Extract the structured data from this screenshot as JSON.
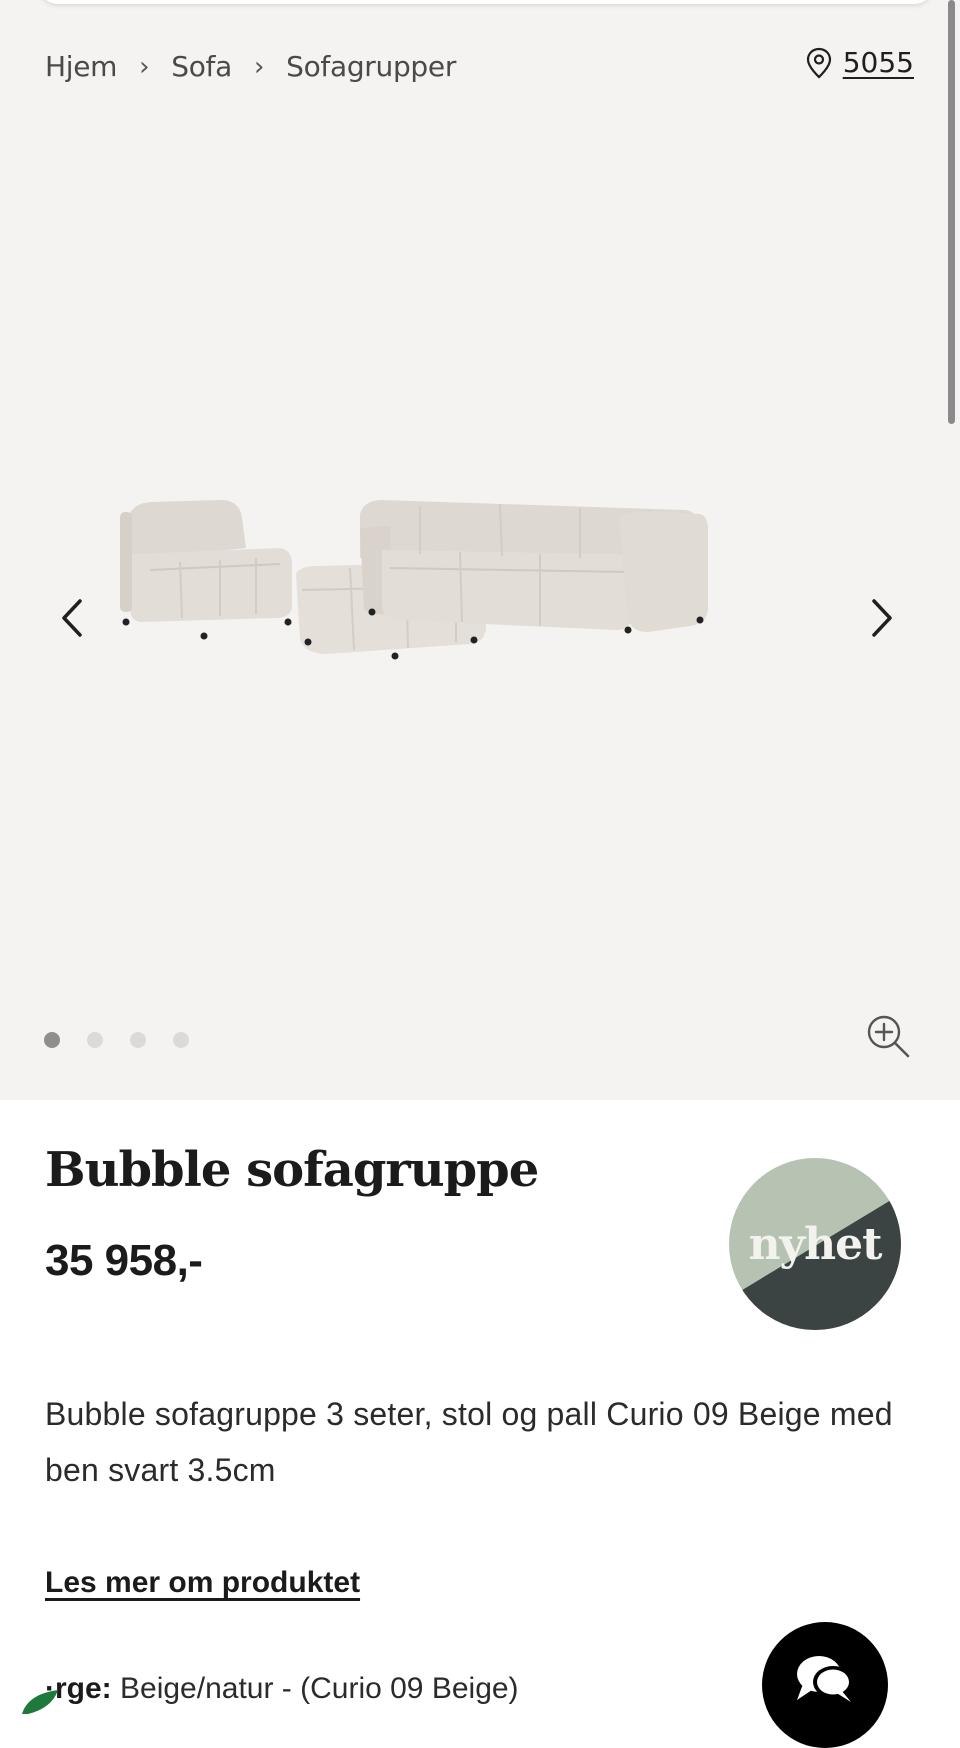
{
  "breadcrumb": {
    "items": [
      "Hjem",
      "Sofa",
      "Sofagrupper"
    ],
    "separator": "›"
  },
  "location": {
    "code": "5055",
    "icon": "map-pin-icon"
  },
  "gallery": {
    "image_alt": "Bubble sofagruppe",
    "slide_count": 4,
    "active_slide": 1,
    "prev_icon": "chevron-left-icon",
    "next_icon": "chevron-right-icon",
    "zoom_icon": "zoom-in-icon"
  },
  "product": {
    "title": "Bubble sofagruppe",
    "price": "35 958,-",
    "badge": "nyhet",
    "description": "Bubble sofagruppe 3 seter, stol og pall Curio 09 Beige med ben svart 3.5cm",
    "read_more": "Les mer om produktet",
    "color_label": "·rge:",
    "color_value": " Beige/natur - (Curio 09 Beige)"
  },
  "colors": {
    "background_gallery": "#f5f3f1",
    "badge_light": "#b6c3b2",
    "badge_dark": "#3b4442",
    "text": "#1b1b1b"
  }
}
